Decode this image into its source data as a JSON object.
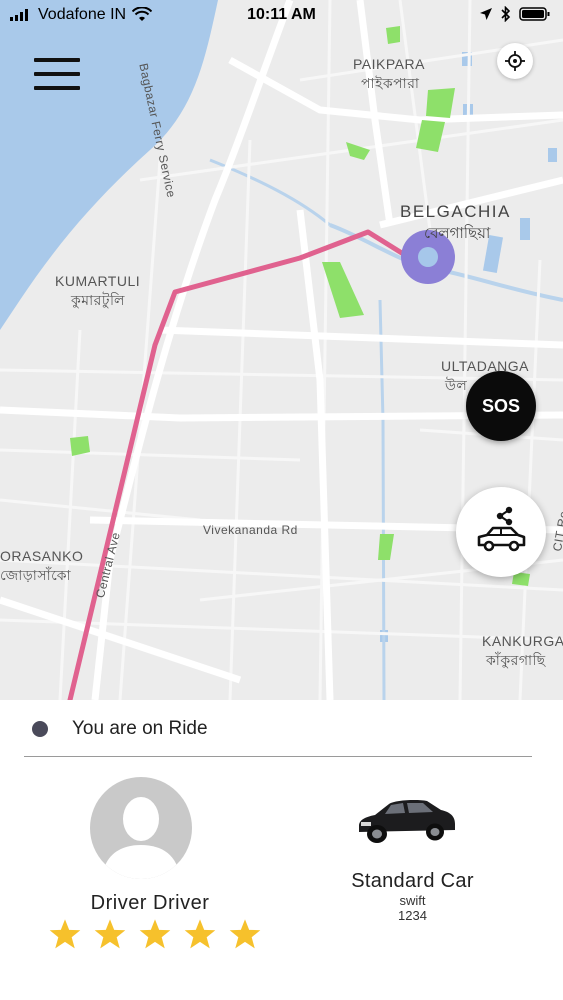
{
  "status_bar": {
    "carrier": "Vodafone IN",
    "time": "10:11 AM"
  },
  "map": {
    "places": [
      {
        "name": "PAIKPARA",
        "native": "পাইকপারা"
      },
      {
        "name": "BELGACHIA",
        "native": "বেলগাছিয়া"
      },
      {
        "name": "KUMARTULI",
        "native": "কুমারটুলি"
      },
      {
        "name": "ULTADANGA",
        "native": "উল"
      },
      {
        "name": "ORASANKO",
        "native": "জোড়াসাঁকো"
      },
      {
        "name": "KANKURGA",
        "native": "কাঁকুরগাছি"
      }
    ],
    "roads": {
      "ferry": "Bagbazar Ferry Service",
      "vivekananda": "Vivekananda Rd",
      "central": "Central Ave",
      "cit": "CIT Ro"
    },
    "route_color": "#e0628f",
    "marker_color": "#8b7fd6"
  },
  "buttons": {
    "menu_icon": "hamburger-icon",
    "locate_icon": "crosshair-icon",
    "sos_label": "SOS",
    "share_icon": "share-car-icon"
  },
  "ride": {
    "status_text": "You are on Ride",
    "driver_name": "Driver Driver",
    "driver_rating": 5,
    "car_type": "Standard Car",
    "car_model": "swift",
    "car_number": "1234"
  },
  "colors": {
    "water": "#a9c9ea",
    "park": "#8ee06a",
    "star": "#f6c12c",
    "status_dot": "#4a4a5a"
  }
}
